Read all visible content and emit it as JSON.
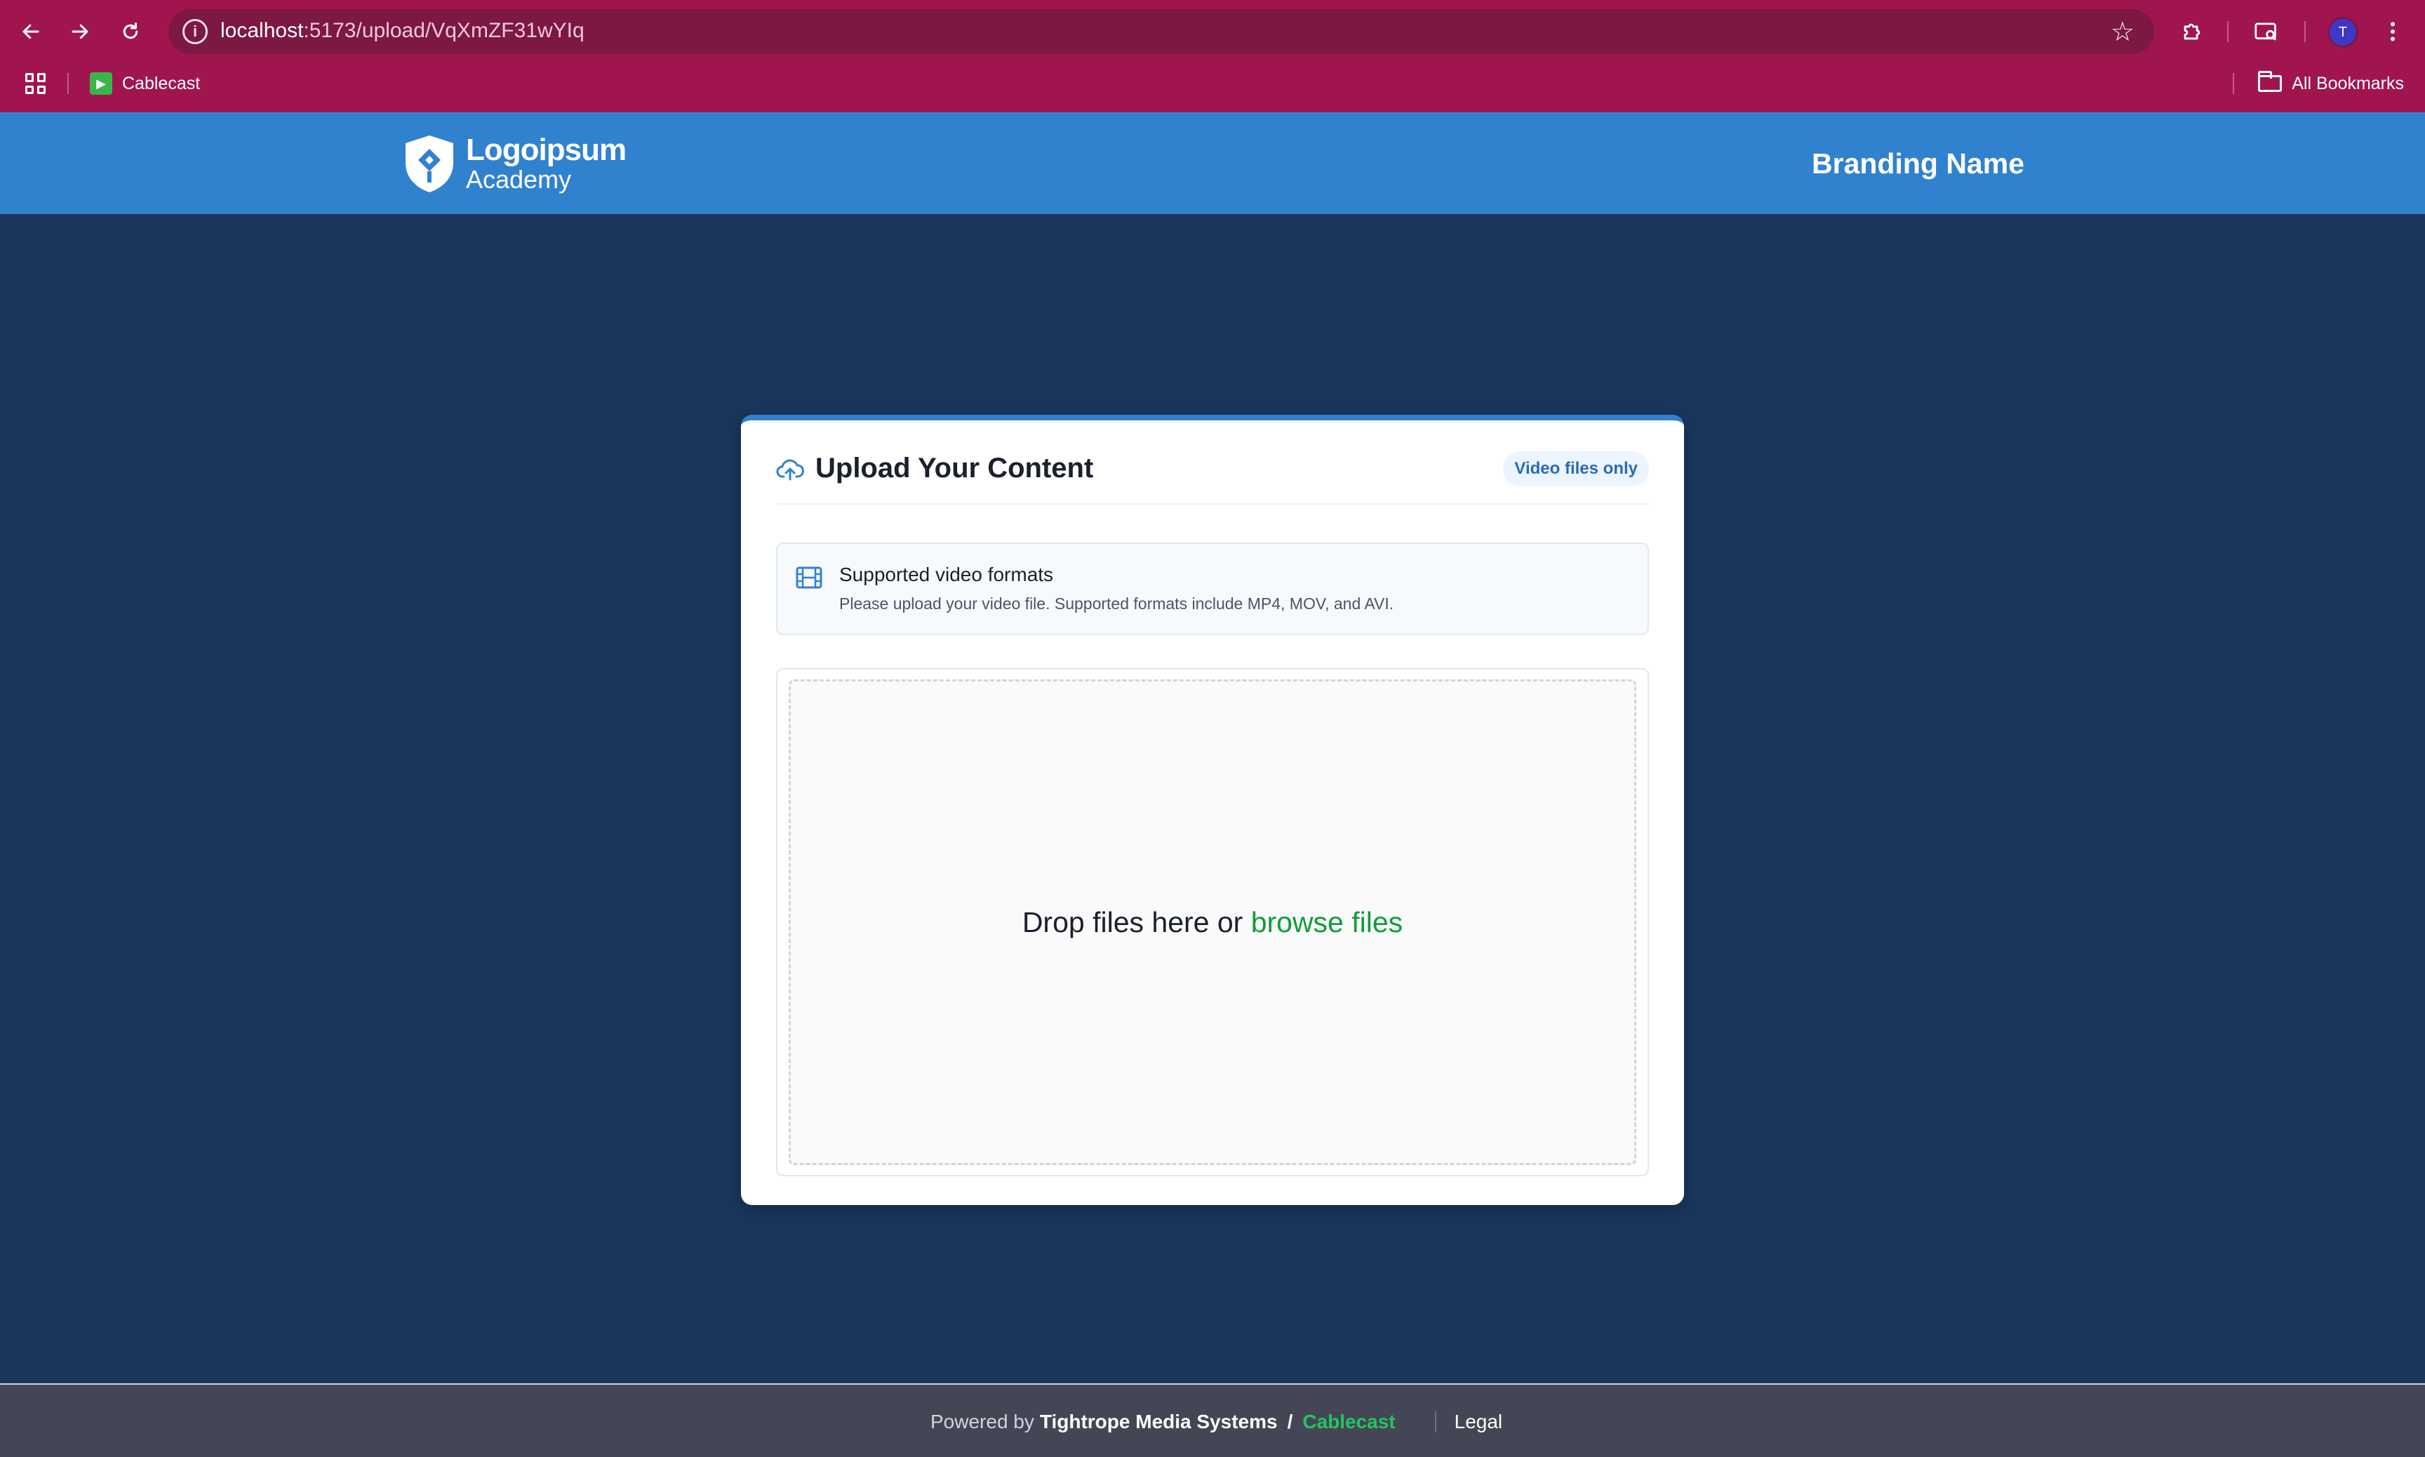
{
  "browser": {
    "url_host": "localhost",
    "url_path": ":5173/upload/VqXmZF31wYIq",
    "avatar_letter": "T",
    "bookmarks": [
      {
        "label": "Cablecast",
        "icon": "cablecast-favicon"
      }
    ],
    "all_bookmarks_label": "All Bookmarks",
    "theme_color": "#a0154f"
  },
  "header": {
    "logo_line1": "Logoipsum",
    "logo_line2": "Academy",
    "branding_name": "Branding Name",
    "bg_color": "#3182ce"
  },
  "card": {
    "title": "Upload Your Content",
    "badge": "Video files only",
    "info_title": "Supported video formats",
    "info_desc": "Please upload your video file. Supported formats include MP4, MOV, and AVI.",
    "drop_text": "Drop files here or ",
    "browse_label": "browse files"
  },
  "footer": {
    "powered_by": "Powered by",
    "company": "Tightrope Media Systems",
    "slash": "/",
    "product": "Cablecast",
    "legal_label": "Legal"
  }
}
